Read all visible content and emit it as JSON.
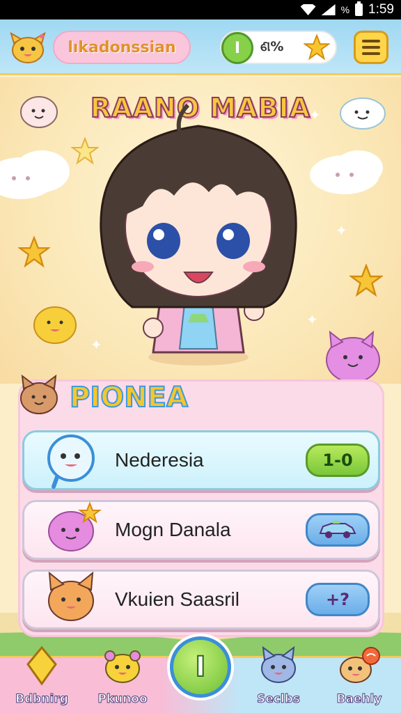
{
  "status_bar": {
    "time": "1:59",
    "battery_text": "%"
  },
  "header": {
    "player_name": "lıkadonssian",
    "coin_label": "I",
    "stat_value": "ଣ%"
  },
  "game_title": "RAANO MABIA",
  "panel": {
    "title": "PIONEA",
    "rows": [
      {
        "label": "Nederesia",
        "button": "1-0"
      },
      {
        "label": "Mogn Danala",
        "button": ""
      },
      {
        "label": "Vkuien Saasril",
        "button": "+?"
      }
    ]
  },
  "bottom_nav": {
    "items": [
      {
        "label": "Bdbnirg"
      },
      {
        "label": "Pkunoo"
      },
      {
        "label": "Seclbs"
      },
      {
        "label": "Baehly"
      }
    ],
    "center_label": "I"
  },
  "colors": {
    "accent": "#f5c62d",
    "panel_bg": "#fcdbe9",
    "header_bg": "#9fd8f2"
  }
}
